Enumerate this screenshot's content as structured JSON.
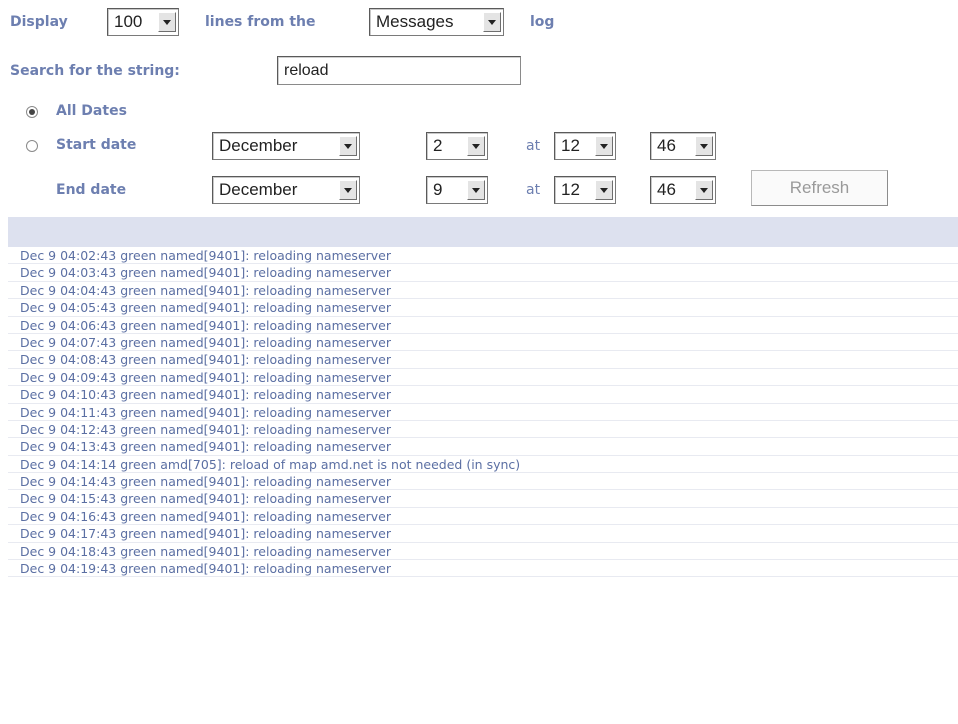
{
  "controls": {
    "display_label": "Display",
    "lines_value": "100",
    "lines_from_label": "lines from the",
    "log_source_value": "Messages",
    "log_label": "log",
    "search_label": "Search for the string:",
    "search_value": "reload",
    "all_dates_label": "All Dates",
    "all_dates_selected": true,
    "start_date_label": "Start date",
    "end_date_label": "End date",
    "at_label": "at",
    "start": {
      "month": "December",
      "day": "2",
      "hour": "12",
      "minute": "46"
    },
    "end": {
      "month": "December",
      "day": "9",
      "hour": "12",
      "minute": "46"
    },
    "refresh_label": "Refresh"
  },
  "log_lines": [
    "Dec 9 04:02:43 green named[9401]: reloading nameserver",
    "Dec 9 04:03:43 green named[9401]: reloading nameserver",
    "Dec 9 04:04:43 green named[9401]: reloading nameserver",
    "Dec 9 04:05:43 green named[9401]: reloading nameserver",
    "Dec 9 04:06:43 green named[9401]: reloading nameserver",
    "Dec 9 04:07:43 green named[9401]: reloading nameserver",
    "Dec 9 04:08:43 green named[9401]: reloading nameserver",
    "Dec 9 04:09:43 green named[9401]: reloading nameserver",
    "Dec 9 04:10:43 green named[9401]: reloading nameserver",
    "Dec 9 04:11:43 green named[9401]: reloading nameserver",
    "Dec 9 04:12:43 green named[9401]: reloading nameserver",
    "Dec 9 04:13:43 green named[9401]: reloading nameserver",
    "Dec 9 04:14:14 green amd[705]: reload of map amd.net is not needed (in sync)",
    "Dec 9 04:14:43 green named[9401]: reloading nameserver",
    "Dec 9 04:15:43 green named[9401]: reloading nameserver",
    "Dec 9 04:16:43 green named[9401]: reloading nameserver",
    "Dec 9 04:17:43 green named[9401]: reloading nameserver",
    "Dec 9 04:18:43 green named[9401]: reloading nameserver",
    "Dec 9 04:19:43 green named[9401]: reloading nameserver"
  ]
}
